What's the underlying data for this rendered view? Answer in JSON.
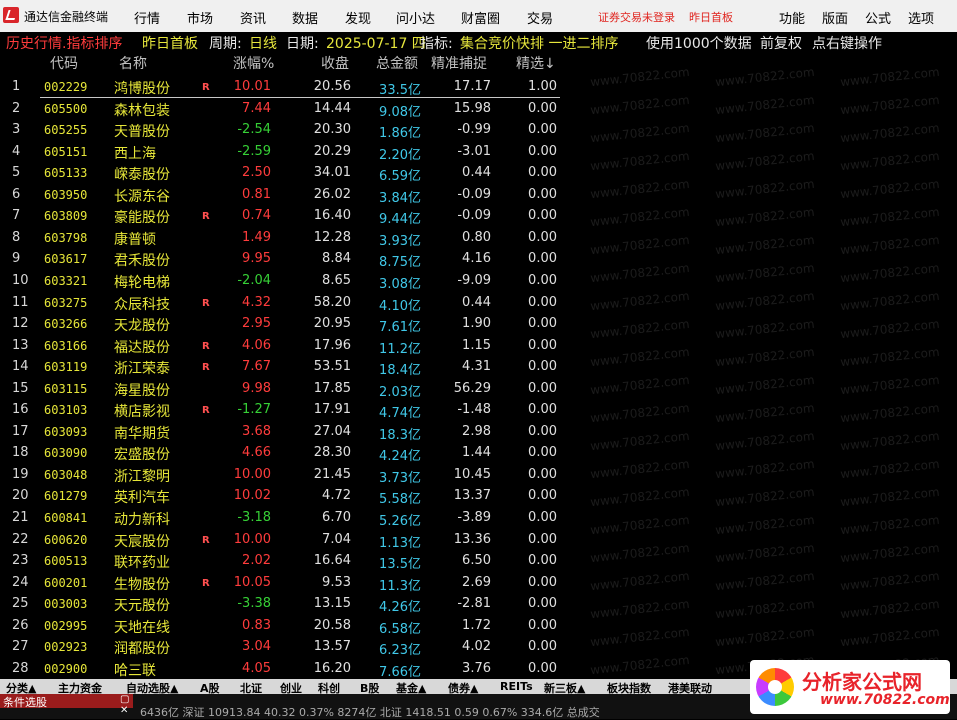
{
  "app": {
    "title": "通达信金融终端"
  },
  "menu": {
    "items": [
      "行情",
      "市场",
      "资讯",
      "数据",
      "发现",
      "问小达",
      "财富圈",
      "交易"
    ],
    "login_status": "证券交易未登录",
    "prev_board": "昨日首板",
    "right_items": [
      "功能",
      "版面",
      "公式",
      "选项"
    ]
  },
  "info": {
    "mode": "历史行情.指标排序",
    "board": "昨日首板",
    "period_label": "周期:",
    "period": "日线",
    "date_label": "日期:",
    "date": "2025-07-17 四",
    "indicator_label": "指标:",
    "indicator": "集合竞价快排 一进二排序",
    "data_note": "使用1000个数据",
    "adjust": "前复权",
    "hint": "点右键操作"
  },
  "headers": {
    "code": "代码",
    "name": "名称",
    "change": "涨幅%",
    "close": "收盘",
    "amount": "总金额",
    "capture": "精准捕捉",
    "select": "精选↓"
  },
  "rows": [
    {
      "idx": "1",
      "code": "002229",
      "name": "鸿博股份",
      "r": "R",
      "change": "10.01",
      "dir": "up",
      "close": "20.56",
      "amount": "33.5亿",
      "capture": "17.17",
      "select": "1.00"
    },
    {
      "idx": "2",
      "code": "605500",
      "name": "森林包装",
      "r": "",
      "change": "7.44",
      "dir": "up",
      "close": "14.44",
      "amount": "9.08亿",
      "capture": "15.98",
      "select": "0.00"
    },
    {
      "idx": "3",
      "code": "605255",
      "name": "天普股份",
      "r": "",
      "change": "-2.54",
      "dir": "down",
      "close": "20.30",
      "amount": "1.86亿",
      "capture": "-0.99",
      "select": "0.00"
    },
    {
      "idx": "4",
      "code": "605151",
      "name": "西上海",
      "r": "",
      "change": "-2.59",
      "dir": "down",
      "close": "20.29",
      "amount": "2.20亿",
      "capture": "-3.01",
      "select": "0.00"
    },
    {
      "idx": "5",
      "code": "605133",
      "name": "嵘泰股份",
      "r": "",
      "change": "2.50",
      "dir": "up",
      "close": "34.01",
      "amount": "6.59亿",
      "capture": "0.44",
      "select": "0.00"
    },
    {
      "idx": "6",
      "code": "603950",
      "name": "长源东谷",
      "r": "",
      "change": "0.81",
      "dir": "up",
      "close": "26.02",
      "amount": "3.84亿",
      "capture": "-0.09",
      "select": "0.00"
    },
    {
      "idx": "7",
      "code": "603809",
      "name": "豪能股份",
      "r": "R",
      "change": "0.74",
      "dir": "up",
      "close": "16.40",
      "amount": "9.44亿",
      "capture": "-0.09",
      "select": "0.00"
    },
    {
      "idx": "8",
      "code": "603798",
      "name": "康普顿",
      "r": "",
      "change": "1.49",
      "dir": "up",
      "close": "12.28",
      "amount": "3.93亿",
      "capture": "0.80",
      "select": "0.00"
    },
    {
      "idx": "9",
      "code": "603617",
      "name": "君禾股份",
      "r": "",
      "change": "9.95",
      "dir": "up",
      "close": "8.84",
      "amount": "8.75亿",
      "capture": "4.16",
      "select": "0.00"
    },
    {
      "idx": "10",
      "code": "603321",
      "name": "梅轮电梯",
      "r": "",
      "change": "-2.04",
      "dir": "down",
      "close": "8.65",
      "amount": "3.08亿",
      "capture": "-9.09",
      "select": "0.00"
    },
    {
      "idx": "11",
      "code": "603275",
      "name": "众辰科技",
      "r": "R",
      "change": "4.32",
      "dir": "up",
      "close": "58.20",
      "amount": "4.10亿",
      "capture": "0.44",
      "select": "0.00"
    },
    {
      "idx": "12",
      "code": "603266",
      "name": "天龙股份",
      "r": "",
      "change": "2.95",
      "dir": "up",
      "close": "20.95",
      "amount": "7.61亿",
      "capture": "1.90",
      "select": "0.00"
    },
    {
      "idx": "13",
      "code": "603166",
      "name": "福达股份",
      "r": "R",
      "change": "4.06",
      "dir": "up",
      "close": "17.96",
      "amount": "11.2亿",
      "capture": "1.15",
      "select": "0.00"
    },
    {
      "idx": "14",
      "code": "603119",
      "name": "浙江荣泰",
      "r": "R",
      "change": "7.67",
      "dir": "up",
      "close": "53.51",
      "amount": "18.4亿",
      "capture": "4.31",
      "select": "0.00"
    },
    {
      "idx": "15",
      "code": "603115",
      "name": "海星股份",
      "r": "",
      "change": "9.98",
      "dir": "up",
      "close": "17.85",
      "amount": "2.03亿",
      "capture": "56.29",
      "select": "0.00"
    },
    {
      "idx": "16",
      "code": "603103",
      "name": "横店影视",
      "r": "R",
      "change": "-1.27",
      "dir": "down",
      "close": "17.91",
      "amount": "4.74亿",
      "capture": "-1.48",
      "select": "0.00"
    },
    {
      "idx": "17",
      "code": "603093",
      "name": "南华期货",
      "r": "",
      "change": "3.68",
      "dir": "up",
      "close": "27.04",
      "amount": "18.3亿",
      "capture": "2.98",
      "select": "0.00"
    },
    {
      "idx": "18",
      "code": "603090",
      "name": "宏盛股份",
      "r": "",
      "change": "4.66",
      "dir": "up",
      "close": "28.30",
      "amount": "4.24亿",
      "capture": "1.44",
      "select": "0.00"
    },
    {
      "idx": "19",
      "code": "603048",
      "name": "浙江黎明",
      "r": "",
      "change": "10.00",
      "dir": "up",
      "close": "21.45",
      "amount": "3.73亿",
      "capture": "10.45",
      "select": "0.00"
    },
    {
      "idx": "20",
      "code": "601279",
      "name": "英利汽车",
      "r": "",
      "change": "10.02",
      "dir": "up",
      "close": "4.72",
      "amount": "5.58亿",
      "capture": "13.37",
      "select": "0.00"
    },
    {
      "idx": "21",
      "code": "600841",
      "name": "动力新科",
      "r": "",
      "change": "-3.18",
      "dir": "down",
      "close": "6.70",
      "amount": "5.26亿",
      "capture": "-3.89",
      "select": "0.00"
    },
    {
      "idx": "22",
      "code": "600620",
      "name": "天宸股份",
      "r": "R",
      "change": "10.00",
      "dir": "up",
      "close": "7.04",
      "amount": "1.13亿",
      "capture": "13.36",
      "select": "0.00"
    },
    {
      "idx": "23",
      "code": "600513",
      "name": "联环药业",
      "r": "",
      "change": "2.02",
      "dir": "up",
      "close": "16.64",
      "amount": "13.5亿",
      "capture": "6.50",
      "select": "0.00"
    },
    {
      "idx": "24",
      "code": "600201",
      "name": "生物股份",
      "r": "R",
      "change": "10.05",
      "dir": "up",
      "close": "9.53",
      "amount": "11.3亿",
      "capture": "2.69",
      "select": "0.00"
    },
    {
      "idx": "25",
      "code": "003003",
      "name": "天元股份",
      "r": "",
      "change": "-3.38",
      "dir": "down",
      "close": "13.15",
      "amount": "4.26亿",
      "capture": "-2.81",
      "select": "0.00"
    },
    {
      "idx": "26",
      "code": "002995",
      "name": "天地在线",
      "r": "",
      "change": "0.83",
      "dir": "up",
      "close": "20.58",
      "amount": "6.58亿",
      "capture": "1.72",
      "select": "0.00"
    },
    {
      "idx": "27",
      "code": "002923",
      "name": "润都股份",
      "r": "",
      "change": "3.04",
      "dir": "up",
      "close": "13.57",
      "amount": "6.23亿",
      "capture": "4.02",
      "select": "0.00"
    },
    {
      "idx": "28",
      "code": "002900",
      "name": "哈三联",
      "r": "",
      "change": "4.05",
      "dir": "up",
      "close": "16.20",
      "amount": "7.66亿",
      "capture": "3.76",
      "select": "0.00"
    }
  ],
  "tabs": [
    "分类▲",
    "主力资金",
    "自动选股▲",
    "A股",
    "北证",
    "创业",
    "科创",
    "B股",
    "基金▲",
    "债券▲",
    "REITs",
    "新三板▲",
    "板块指数",
    "港美联动"
  ],
  "status": {
    "panel_label": "条件选股",
    "panel_buttons": "▢ ✕",
    "ticker": "6436亿  深证 10913.84  40.32  0.37%  8274亿  北证 1418.51  0.59  0.67%  334.6亿  总成交"
  },
  "brand": {
    "title": "分析家公式网",
    "url": "www.70822.com"
  },
  "watermark": "www.70822.com"
}
